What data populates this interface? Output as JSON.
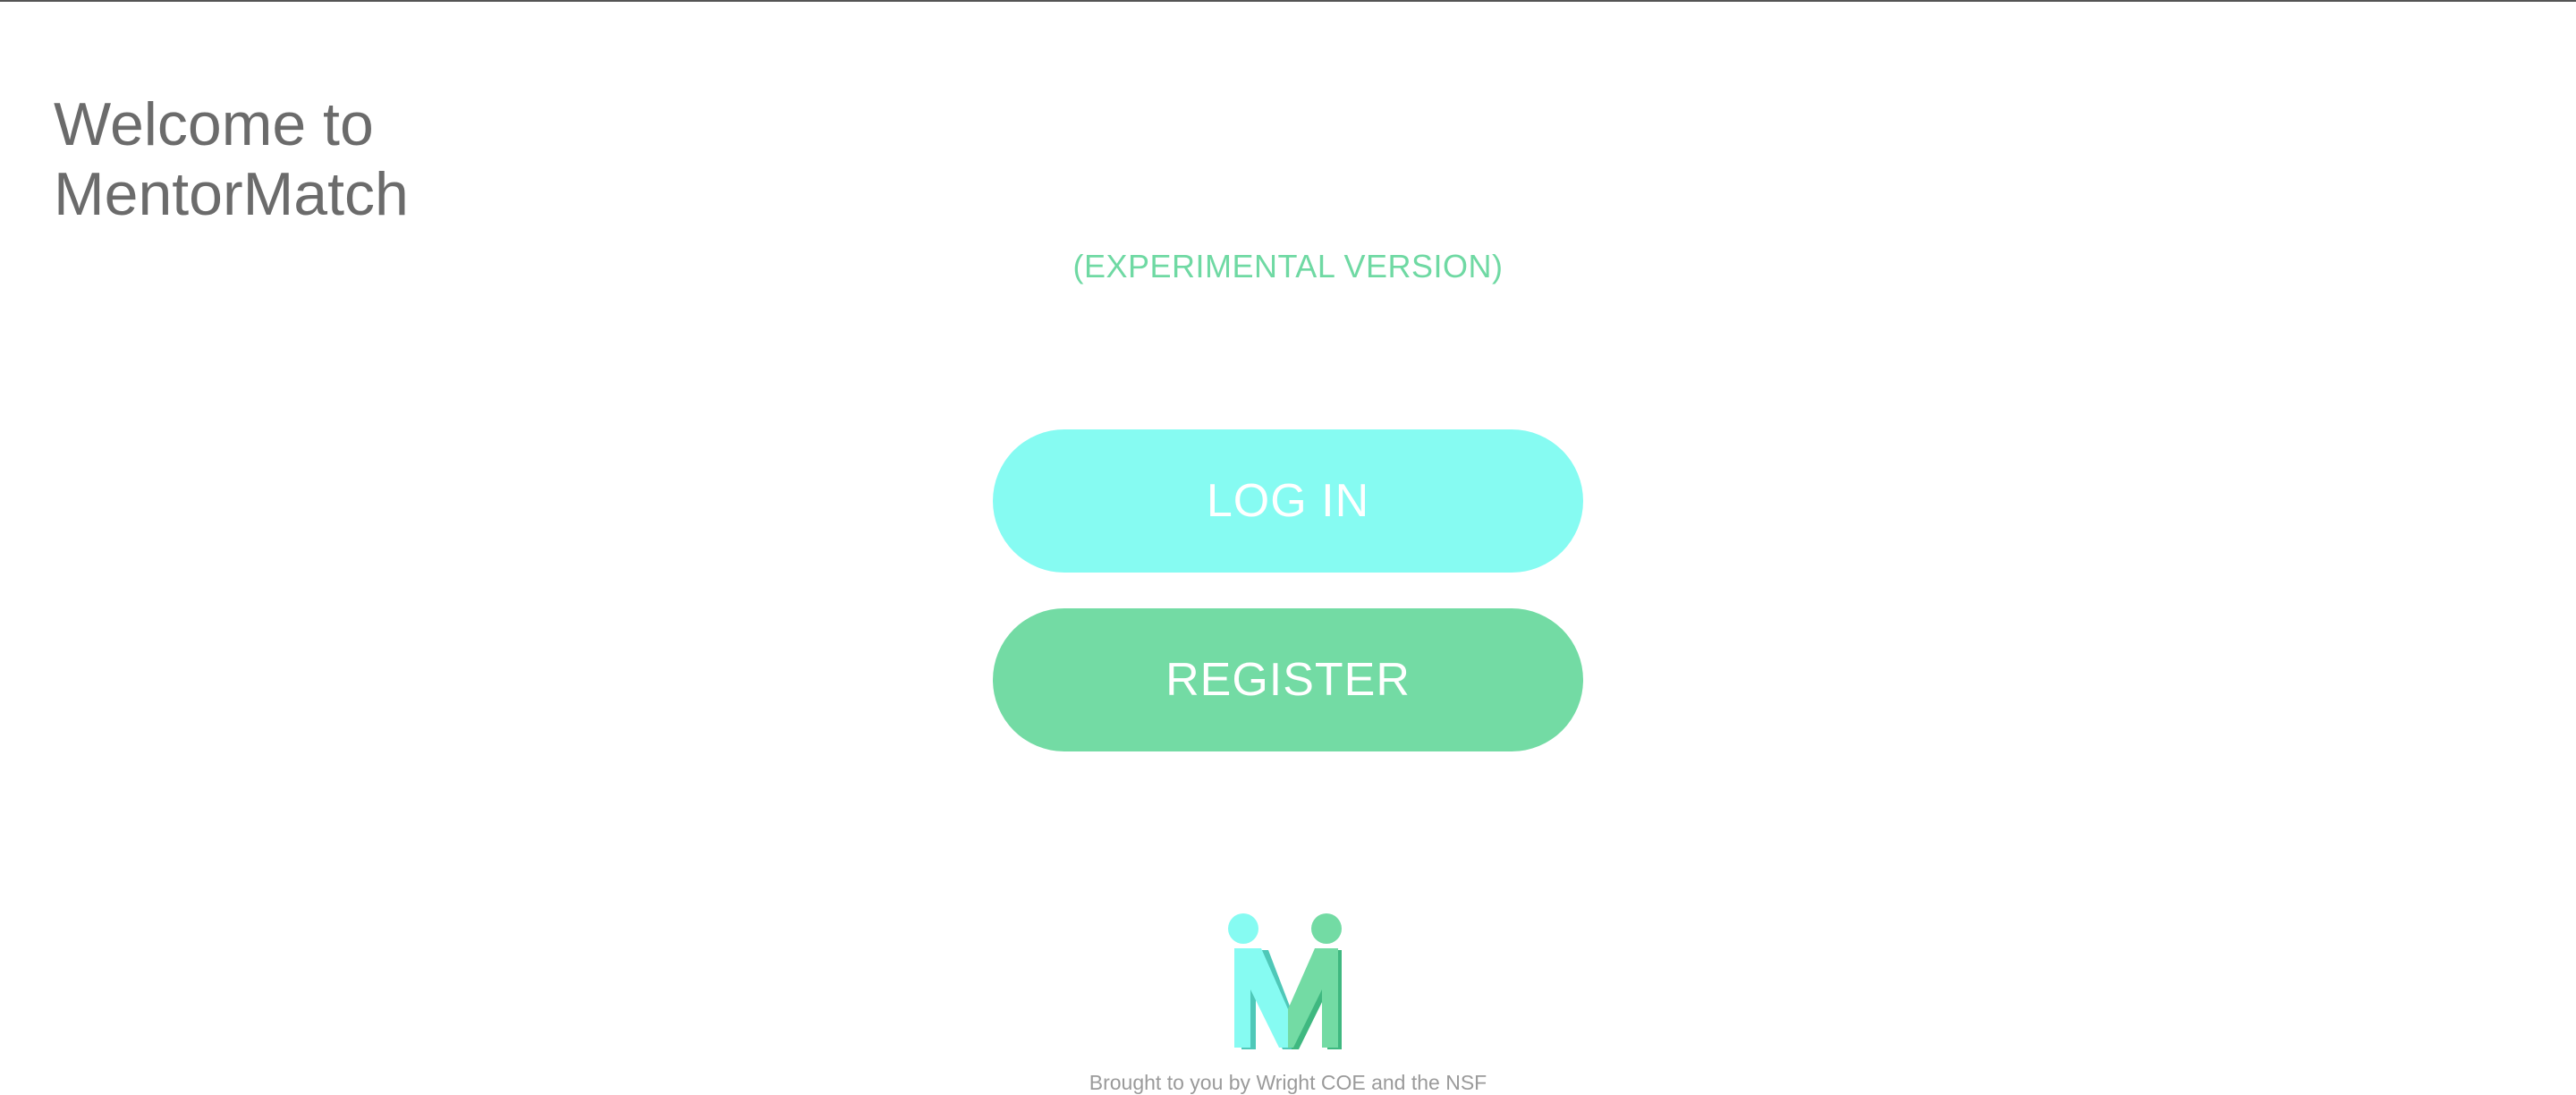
{
  "welcome": {
    "line1": "Welcome to",
    "line2": "MentorMatch"
  },
  "subtitle": "(EXPERIMENTAL VERSION)",
  "buttons": {
    "login_label": "LOG IN",
    "register_label": "REGISTER"
  },
  "logo": {
    "icon": "mentormatch-m-logo-icon",
    "colors": {
      "cyan": "#86fbf2",
      "green": "#73dba4"
    }
  },
  "footer": {
    "text": "Brought to you by Wright COE and the NSF"
  },
  "colors": {
    "heading": "#6b6b6b",
    "accent_green": "#6fd9a3",
    "login_bg": "#86fbf2",
    "register_bg": "#73dba4",
    "footer_text": "#9a9a9a"
  }
}
